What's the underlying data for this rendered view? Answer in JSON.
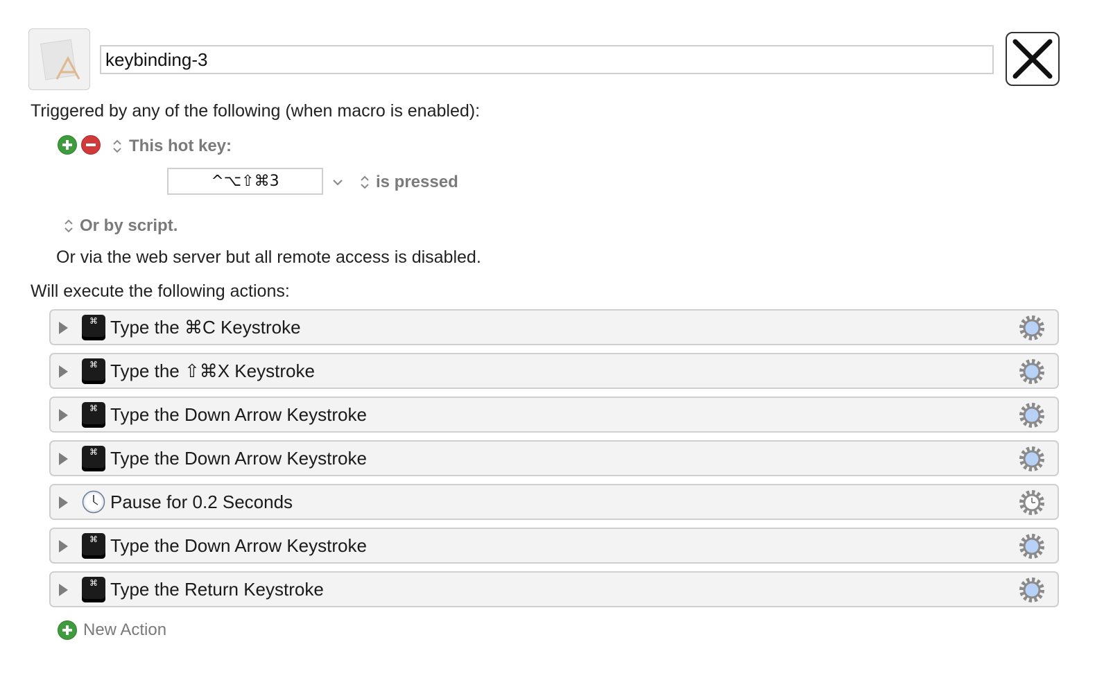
{
  "macro": {
    "name": "keybinding-3"
  },
  "triggers": {
    "heading": "Triggered by any of the following (when macro is enabled):",
    "trigger_type": "This hot key:",
    "hotkey_value": "^⌥⇧⌘3",
    "press_mode": "is pressed",
    "script_option": "Or by script.",
    "web_server_note": "Or via the web server but all remote access is disabled."
  },
  "actions": {
    "heading": "Will execute the following actions:",
    "items": [
      {
        "label": "Type the ⌘C Keystroke",
        "icon": "keystroke-icon"
      },
      {
        "label": "Type the ⇧⌘X Keystroke",
        "icon": "keystroke-icon"
      },
      {
        "label": "Type the Down Arrow Keystroke",
        "icon": "keystroke-icon"
      },
      {
        "label": "Type the Down Arrow Keystroke",
        "icon": "keystroke-icon"
      },
      {
        "label": "Pause for 0.2 Seconds",
        "icon": "clock-icon"
      },
      {
        "label": "Type the Down Arrow Keystroke",
        "icon": "keystroke-icon"
      },
      {
        "label": "Type the Return Keystroke",
        "icon": "keystroke-icon"
      }
    ],
    "new_action_label": "New Action"
  },
  "keycap_glyph": "⌘"
}
